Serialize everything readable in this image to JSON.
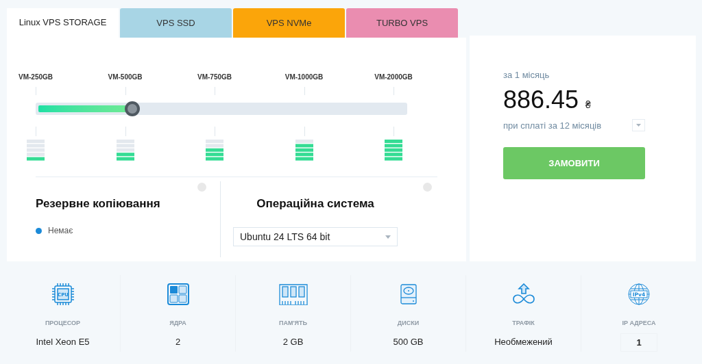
{
  "tabs": [
    {
      "label": "Linux VPS STORAGE",
      "selected": true,
      "color": "#ffffff"
    },
    {
      "label": "VPS SSD",
      "selected": false,
      "color": "#a8d5e5"
    },
    {
      "label": "VPS NVMe",
      "selected": false,
      "color": "#fba50a"
    },
    {
      "label": "TURBO VPS",
      "selected": false,
      "color": "#ea8db0"
    }
  ],
  "plan_slider": {
    "ticks": [
      "VM-250GB",
      "VM-500GB",
      "VM-750GB",
      "VM-1000GB",
      "VM-2000GB"
    ],
    "level": 0.25
  },
  "backup": {
    "title": "Резервне копіювання",
    "options": [
      {
        "label": "Немає",
        "selected": true
      }
    ]
  },
  "os": {
    "title": "Операційна система",
    "value": "Ubuntu 24 LTS 64 bit"
  },
  "price": {
    "period": "за 1 місяць",
    "amount": "886.45",
    "currency": "₴",
    "term": "при сплаті за 12 місяців",
    "order_button": "ЗАМОВИТИ"
  },
  "specs": [
    {
      "kind": "cpu",
      "icon_text": "CPU",
      "label": "ПРОЦЕСОР",
      "value": "Intel Xeon E5"
    },
    {
      "kind": "cores",
      "label": "ЯДРА",
      "value": "2"
    },
    {
      "kind": "ram",
      "label": "ПАМ'ЯТЬ",
      "value": "2 GB"
    },
    {
      "kind": "disk",
      "label": "ДИСКИ",
      "value": "500 GB"
    },
    {
      "kind": "traffic",
      "label": "ТРАФІК",
      "value": "Необмежений"
    },
    {
      "kind": "ip",
      "icon_text": "IPv4",
      "label": "IP АДРЕСА",
      "value": "1",
      "editable": true
    }
  ]
}
